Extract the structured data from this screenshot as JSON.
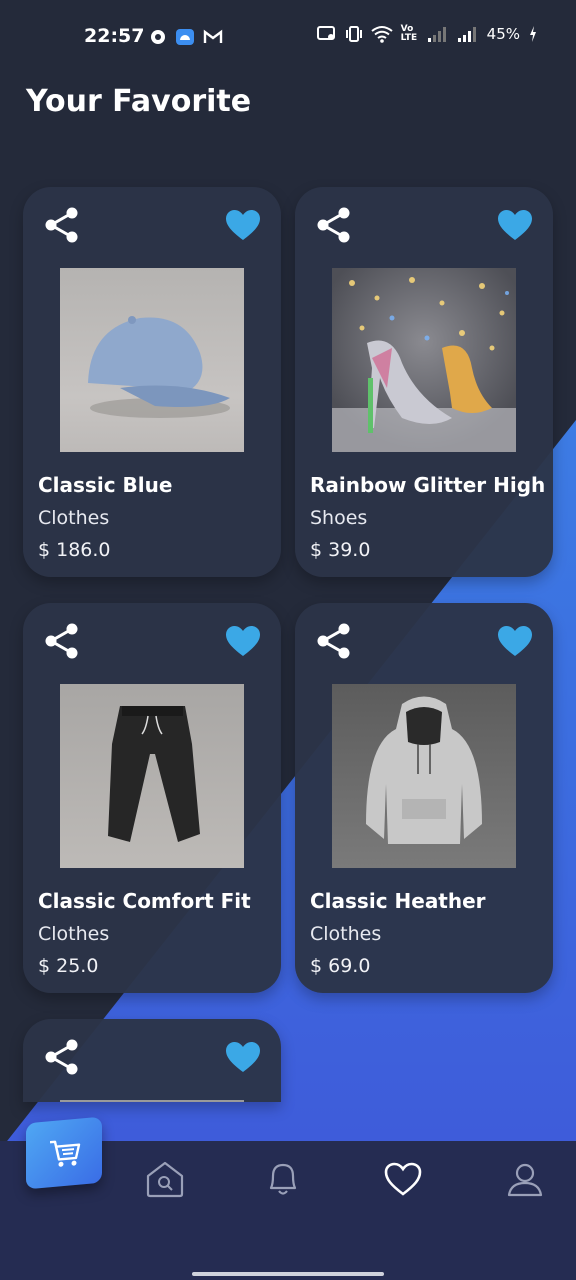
{
  "status_bar": {
    "time": "22:57",
    "volte": "Vo LTE",
    "battery": "45%"
  },
  "page": {
    "title": "Your Favorite"
  },
  "products": [
    {
      "name": "Classic Blue",
      "category": "Clothes",
      "price": "$ 186.0",
      "image": "blue-cap-photo",
      "favorited": true
    },
    {
      "name": "Rainbow Glitter High",
      "category": "Shoes",
      "price": "$ 39.0",
      "image": "glitter-heels-photo",
      "favorited": true
    },
    {
      "name": "Classic Comfort Fit",
      "category": "Clothes",
      "price": "$ 25.0",
      "image": "black-joggers-photo",
      "favorited": true
    },
    {
      "name": "Classic Heather",
      "category": "Clothes",
      "price": "$ 69.0",
      "image": "grey-hoodie-photo",
      "favorited": true
    },
    {
      "name": "",
      "category": "",
      "price": "",
      "image": "",
      "favorited": true
    }
  ],
  "bottom_nav": {
    "items": [
      "cart-icon",
      "home-icon",
      "bell-icon",
      "heart-icon",
      "user-icon"
    ],
    "active": "heart-icon"
  },
  "colors": {
    "background": "#242a3a",
    "card": "#2c3448",
    "accent_blue": "#3f8fe9",
    "heart": "#3ba8e6",
    "nav": "#252c52"
  }
}
